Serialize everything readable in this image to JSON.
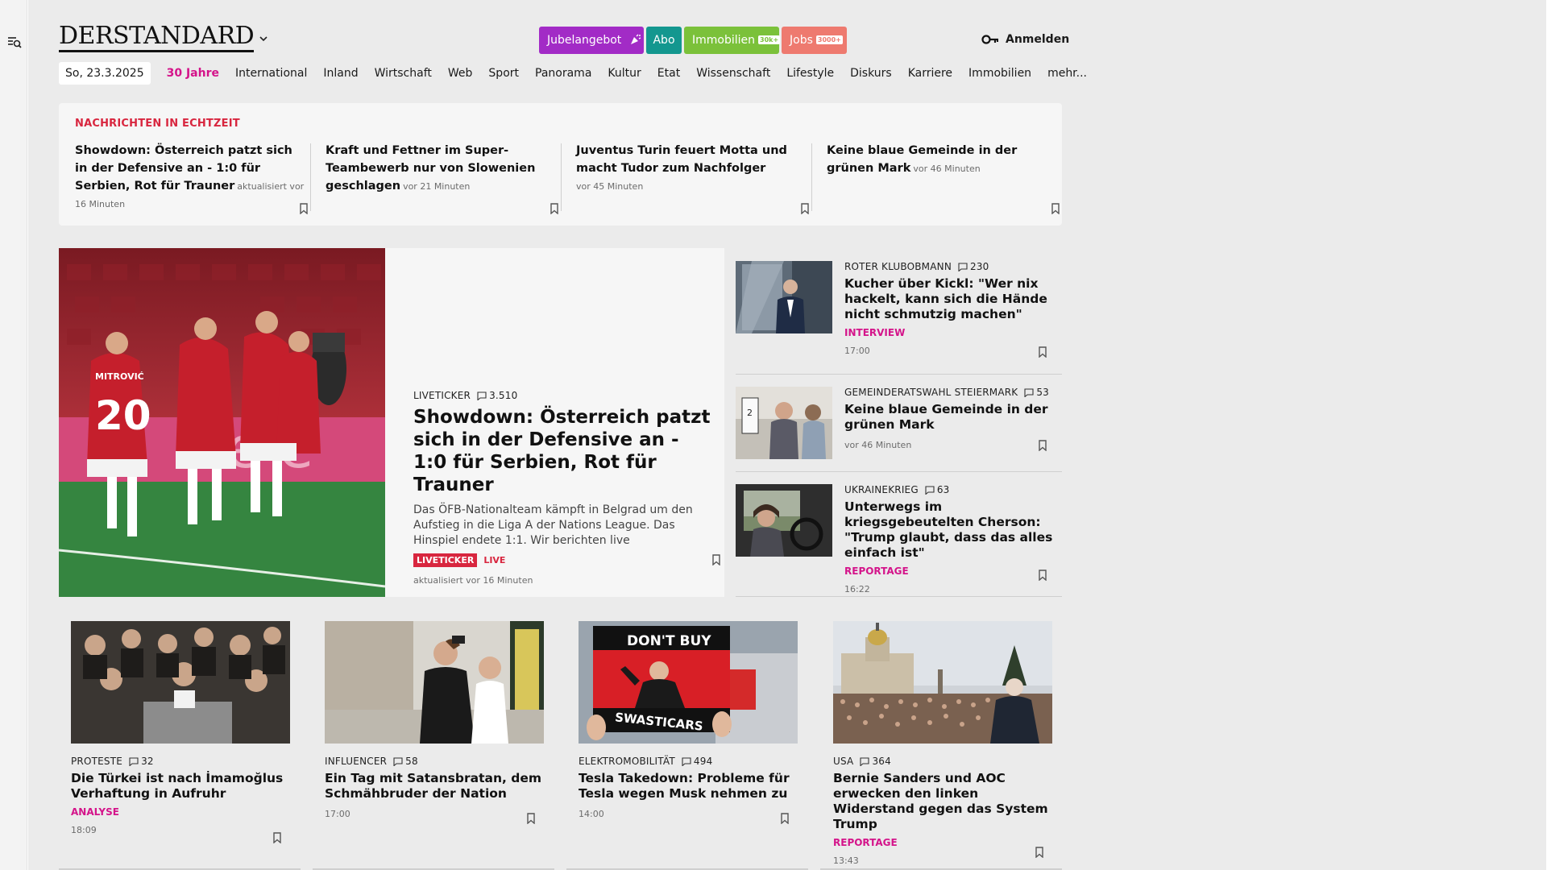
{
  "header": {
    "logo": "DERSTANDARD",
    "promos": {
      "jubel": "Jubelangebot",
      "abo": "Abo",
      "immo": "Immobilien",
      "immo_tag": "30k+",
      "jobs": "Jobs",
      "jobs_tag": "3000+"
    },
    "login": "Anmelden"
  },
  "nav": {
    "date": "So, 23.3.2025",
    "items": [
      "30 Jahre",
      "International",
      "Inland",
      "Wirtschaft",
      "Web",
      "Sport",
      "Panorama",
      "Kultur",
      "Etat",
      "Wissenschaft",
      "Lifestyle",
      "Diskurs",
      "Karriere",
      "Immobilien",
      "mehr..."
    ]
  },
  "realtime": {
    "label": "NACHRICHTEN IN ECHTZEIT",
    "items": [
      {
        "title": "Showdown: Österreich patzt sich in der Defensive an - 1:0 für Serbien, Rot für Trauner",
        "time": "aktualisiert vor 16 Minuten"
      },
      {
        "title": "Kraft und Fettner im Super-Teambewerb nur von Slowenien geschlagen",
        "time": "vor 21 Minuten"
      },
      {
        "title": "Juventus Turin feuert Motta und macht Tudor zum Nachfolger",
        "time": "vor 45 Minuten"
      },
      {
        "title": "Keine blaue Gemeinde in der grünen Mark",
        "time": "vor 46 Minuten"
      }
    ]
  },
  "lead": {
    "kicker": "LIVETICKER",
    "comments": "3.510",
    "title": "Showdown: Österreich patzt sich in der Defensive an - 1:0 für Serbien, Rot für Trauner",
    "teaser": "Das ÖFB-Nationalteam kämpft in Belgrad um den Aufstieg in die Liga A der Nations League. Das Hinspiel endete 1:1. Wir berichten live",
    "badge": "LIVETICKER",
    "live": "LIVE",
    "updated": "aktualisiert vor 16 Minuten",
    "jersey_name": "MITROVIĆ",
    "jersey_number": "20"
  },
  "side": [
    {
      "kicker": "ROTER KLUBOBMANN",
      "comments": "230",
      "title": "Kucher über Kickl: \"Wer nix hackelt, kann sich die Hände nicht schmutzig machen\"",
      "label": "INTERVIEW",
      "time": "17:00"
    },
    {
      "kicker": "GEMEINDERATSWAHL STEIERMARK",
      "comments": "53",
      "title": "Keine blaue Gemeinde in der grünen Mark",
      "label": "",
      "time": "vor 46 Minuten"
    },
    {
      "kicker": "UKRAINEKRIEG",
      "comments": "63",
      "title": "Unterwegs im kriegsgebeutelten Cherson: \"Trump glaubt, dass das alles einfach ist\"",
      "label": "REPORTAGE",
      "time": "16:22"
    }
  ],
  "cards": [
    {
      "kicker": "PROTESTE",
      "comments": "32",
      "title": "Die Türkei ist nach İmamoğlus Verhaftung in Aufruhr",
      "label": "ANALYSE",
      "time": "18:09"
    },
    {
      "kicker": "INFLUENCER",
      "comments": "58",
      "title": "Ein Tag mit Satansbratan, dem Schmähbruder der Nation",
      "label": "",
      "time": "17:00"
    },
    {
      "kicker": "ELEKTROMOBILITÄT",
      "comments": "494",
      "title": "Tesla Takedown: Probleme für Tesla wegen Musk nehmen zu",
      "label": "",
      "time": "14:00",
      "sign_top": "DON'T BUY",
      "sign_bottom": "SWASTICARS"
    },
    {
      "kicker": "USA",
      "comments": "364",
      "title": "Bernie Sanders und AOC erwecken den linken Widerstand gegen das System Trump",
      "label": "REPORTAGE",
      "time": "13:43"
    }
  ],
  "colors": {
    "accent_magenta": "#d4148a",
    "live_red": "#d8263f",
    "jubel": "#a22bc6",
    "abo": "#13978f",
    "immobilien": "#7bc13a",
    "jobs": "#ee7a6f"
  },
  "icons": {
    "menu": "search-menu-icon",
    "key": "key-icon",
    "comment": "comment-icon",
    "bookmark": "bookmark-icon",
    "chevron": "chevron-down-icon",
    "confetti": "confetti-icon"
  }
}
